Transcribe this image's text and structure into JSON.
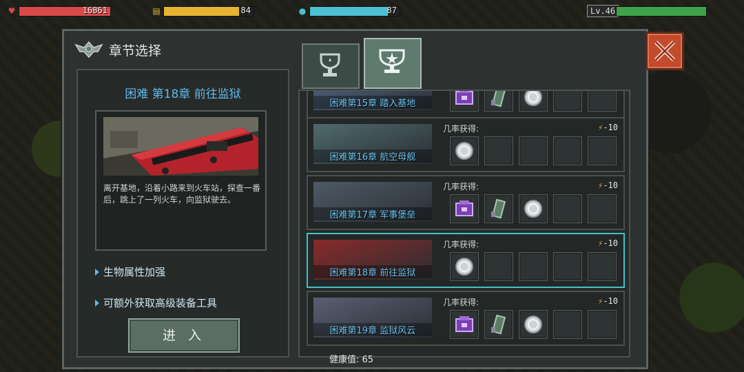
{
  "hud": {
    "hp": {
      "value": "16861",
      "icon": "heart-icon",
      "color": "#d84a4a",
      "fill": 1.0
    },
    "food": {
      "value": "84",
      "icon": "food-icon",
      "color": "#e4b432",
      "fill": 0.84
    },
    "water": {
      "value": "87",
      "icon": "water-drop-icon",
      "color": "#4cbfd0",
      "fill": 0.87
    },
    "level": {
      "label": "Lv.46",
      "color": "#3fa24a",
      "fill": 1.0
    }
  },
  "panel": {
    "title": "章节选择",
    "selected_chapter_title": "困难 第18章 前往监狱",
    "description": "离开基地，沿着小路来到火车站，探查一番后，跳上了一列火车，向监狱驶去。",
    "perks": [
      "生物属性加强",
      "可额外获取高级装备工具"
    ],
    "enter_button": "进 入",
    "health_text": "健康值: 65",
    "tabs": [
      {
        "icon": "trophy-icon",
        "active": false
      },
      {
        "icon": "trophy-star-icon",
        "active": true
      }
    ]
  },
  "chapters": [
    {
      "name": "困难第15章 踏入基地",
      "drop_label": "",
      "cost": "",
      "items": [
        "purple-crate-icon",
        "green-tool-icon",
        "silver-coin-icon"
      ],
      "selected": false
    },
    {
      "name": "困难第16章 航空母舰",
      "drop_label": "几率获得:",
      "cost": "-10",
      "items": [
        "silver-coin-icon"
      ],
      "selected": false
    },
    {
      "name": "困难第17章 军事堡垒",
      "drop_label": "几率获得:",
      "cost": "-10",
      "items": [
        "purple-crate-icon",
        "green-tool-icon",
        "silver-coin-icon"
      ],
      "selected": false
    },
    {
      "name": "困难第18章 前往监狱",
      "drop_label": "几率获得:",
      "cost": "-10",
      "items": [
        "silver-coin-icon"
      ],
      "selected": true
    },
    {
      "name": "困难第19章 监狱风云",
      "drop_label": "几率获得:",
      "cost": "-10",
      "items": [
        "purple-crate-icon",
        "green-tool-icon",
        "silver-coin-icon"
      ],
      "selected": false
    }
  ],
  "colors": {
    "accent": "#3ec3c9",
    "chapter_text": "#5fb9ea",
    "close_button": "#c44a2c"
  }
}
